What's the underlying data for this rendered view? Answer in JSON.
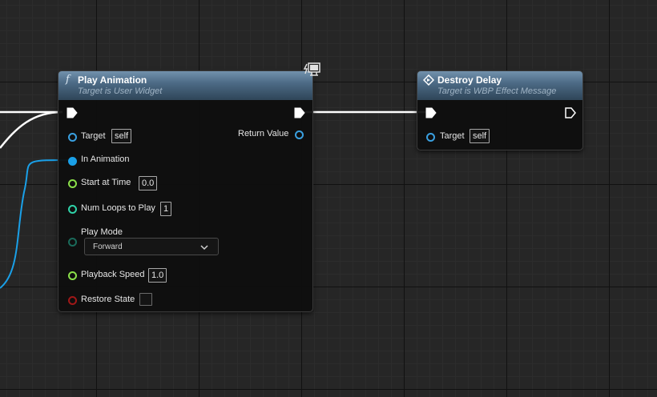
{
  "play_animation_node": {
    "title": "Play Animation",
    "subtitle": "Target is User Widget",
    "icon": "function-icon",
    "pins": {
      "target_label": "Target",
      "target_value": "self",
      "in_animation_label": "In Animation",
      "start_at_time_label": "Start at Time",
      "start_at_time_value": "0.0",
      "num_loops_label": "Num Loops to Play",
      "num_loops_value": "1",
      "play_mode_label": "Play Mode",
      "play_mode_value": "Forward",
      "playback_speed_label": "Playback Speed",
      "playback_speed_value": "1.0",
      "restore_state_label": "Restore State",
      "restore_state_checked": false,
      "return_value_label": "Return Value"
    }
  },
  "destroy_delay_node": {
    "title": "Destroy Delay",
    "subtitle": "Target is WBP Effect Message",
    "icon": "event-diamond-icon",
    "pins": {
      "target_label": "Target",
      "target_value": "self"
    }
  },
  "colors": {
    "header_blue": "#4d6b86",
    "object_pin": "#3aa0e0",
    "float_pin": "#8be04a",
    "int_pin": "#2fd2a8",
    "byte_pin": "#1a6a5a",
    "bool_pin": "#a01818",
    "widget_pin": "#1aa0e8",
    "exec_wire": "#ffffff"
  }
}
